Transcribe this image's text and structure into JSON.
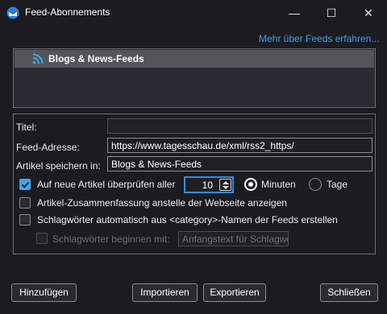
{
  "window": {
    "title": "Feed-Abonnements",
    "minimize_glyph": "—",
    "maximize_glyph": "☐",
    "close_glyph": "✕"
  },
  "more_link": "Mehr über Feeds erfahren...",
  "feed_list": {
    "items": [
      {
        "label": "Blogs & News-Feeds",
        "icon": "rss-icon"
      }
    ]
  },
  "form": {
    "title_label": "Titel:",
    "title_value": "",
    "address_label": "Feed-Adresse:",
    "address_value": "https://www.tagesschau.de/xml/rss2_https/",
    "folder_label": "Artikel speichern in:",
    "folder_value": "Blogs & News-Feeds",
    "check_label": "Auf neue Artikel überprüfen aller",
    "check_checked": true,
    "interval_value": "10",
    "unit_minutes": "Minuten",
    "unit_days": "Tage",
    "unit_selected": "minutes",
    "summary_label": "Artikel-Zusammenfassung anstelle der Webseite anzeigen",
    "summary_checked": false,
    "tags_label": "Schlagwörter automatisch aus <category>-Namen der Feeds erstellen",
    "tags_checked": false,
    "prefix_label": "Schlagwörter beginnen mit:",
    "prefix_checked": false,
    "prefix_placeholder": "Anfangstext für Schlagwörter"
  },
  "buttons": {
    "add": "Hinzufügen",
    "import": "Importieren",
    "export": "Exportieren",
    "close": "Schließen"
  },
  "colors": {
    "background": "#1c1b22",
    "accent": "#3ea7ef",
    "link": "#33a6ef"
  }
}
